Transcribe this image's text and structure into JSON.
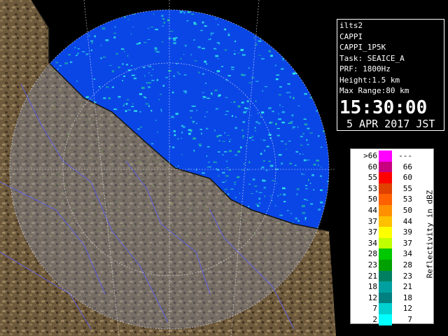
{
  "info": {
    "site": "ilts2",
    "product": "CAPPI",
    "product_code": "CAPPI_1P5K",
    "task": "Task: SEAICE_A",
    "prf": "PRF: 1800Hz",
    "height": "Height:1.5 km",
    "max_range": "Max Range:80 km",
    "time": "15:30:00",
    "date": "5 APR 2017 JST"
  },
  "legend": {
    "title": "Reflectivity in dBZ",
    "rows": [
      {
        "lo": ">66",
        "hi": "---",
        "color": "#ff00ff"
      },
      {
        "lo": "60",
        "hi": "66",
        "color": "#c80080"
      },
      {
        "lo": "55",
        "hi": "60",
        "color": "#ff0000"
      },
      {
        "lo": "53",
        "hi": "55",
        "color": "#e04000"
      },
      {
        "lo": "50",
        "hi": "53",
        "color": "#ff6000"
      },
      {
        "lo": "44",
        "hi": "50",
        "color": "#ff9000"
      },
      {
        "lo": "37",
        "hi": "44",
        "color": "#ffc000"
      },
      {
        "lo": "37",
        "hi": "39",
        "color": "#ffff00"
      },
      {
        "lo": "34",
        "hi": "37",
        "color": "#c0ff00"
      },
      {
        "lo": "28",
        "hi": "34",
        "color": "#00c800"
      },
      {
        "lo": "23",
        "hi": "28",
        "color": "#00a000"
      },
      {
        "lo": "21",
        "hi": "23",
        "color": "#008060"
      },
      {
        "lo": "18",
        "hi": "21",
        "color": "#00a0a0"
      },
      {
        "lo": "12",
        "hi": "18",
        "color": "#008080"
      },
      {
        "lo": "7",
        "hi": "12",
        "color": "#00d0d0"
      },
      {
        "lo": "2",
        "hi": "7",
        "color": "#00ffff"
      }
    ]
  },
  "colors": {
    "sea": "#0a46e6",
    "land": "#6e5a3c",
    "echo": "#30e8e8",
    "range_ring": "#ffffff",
    "panel_border": "#ffffff"
  }
}
